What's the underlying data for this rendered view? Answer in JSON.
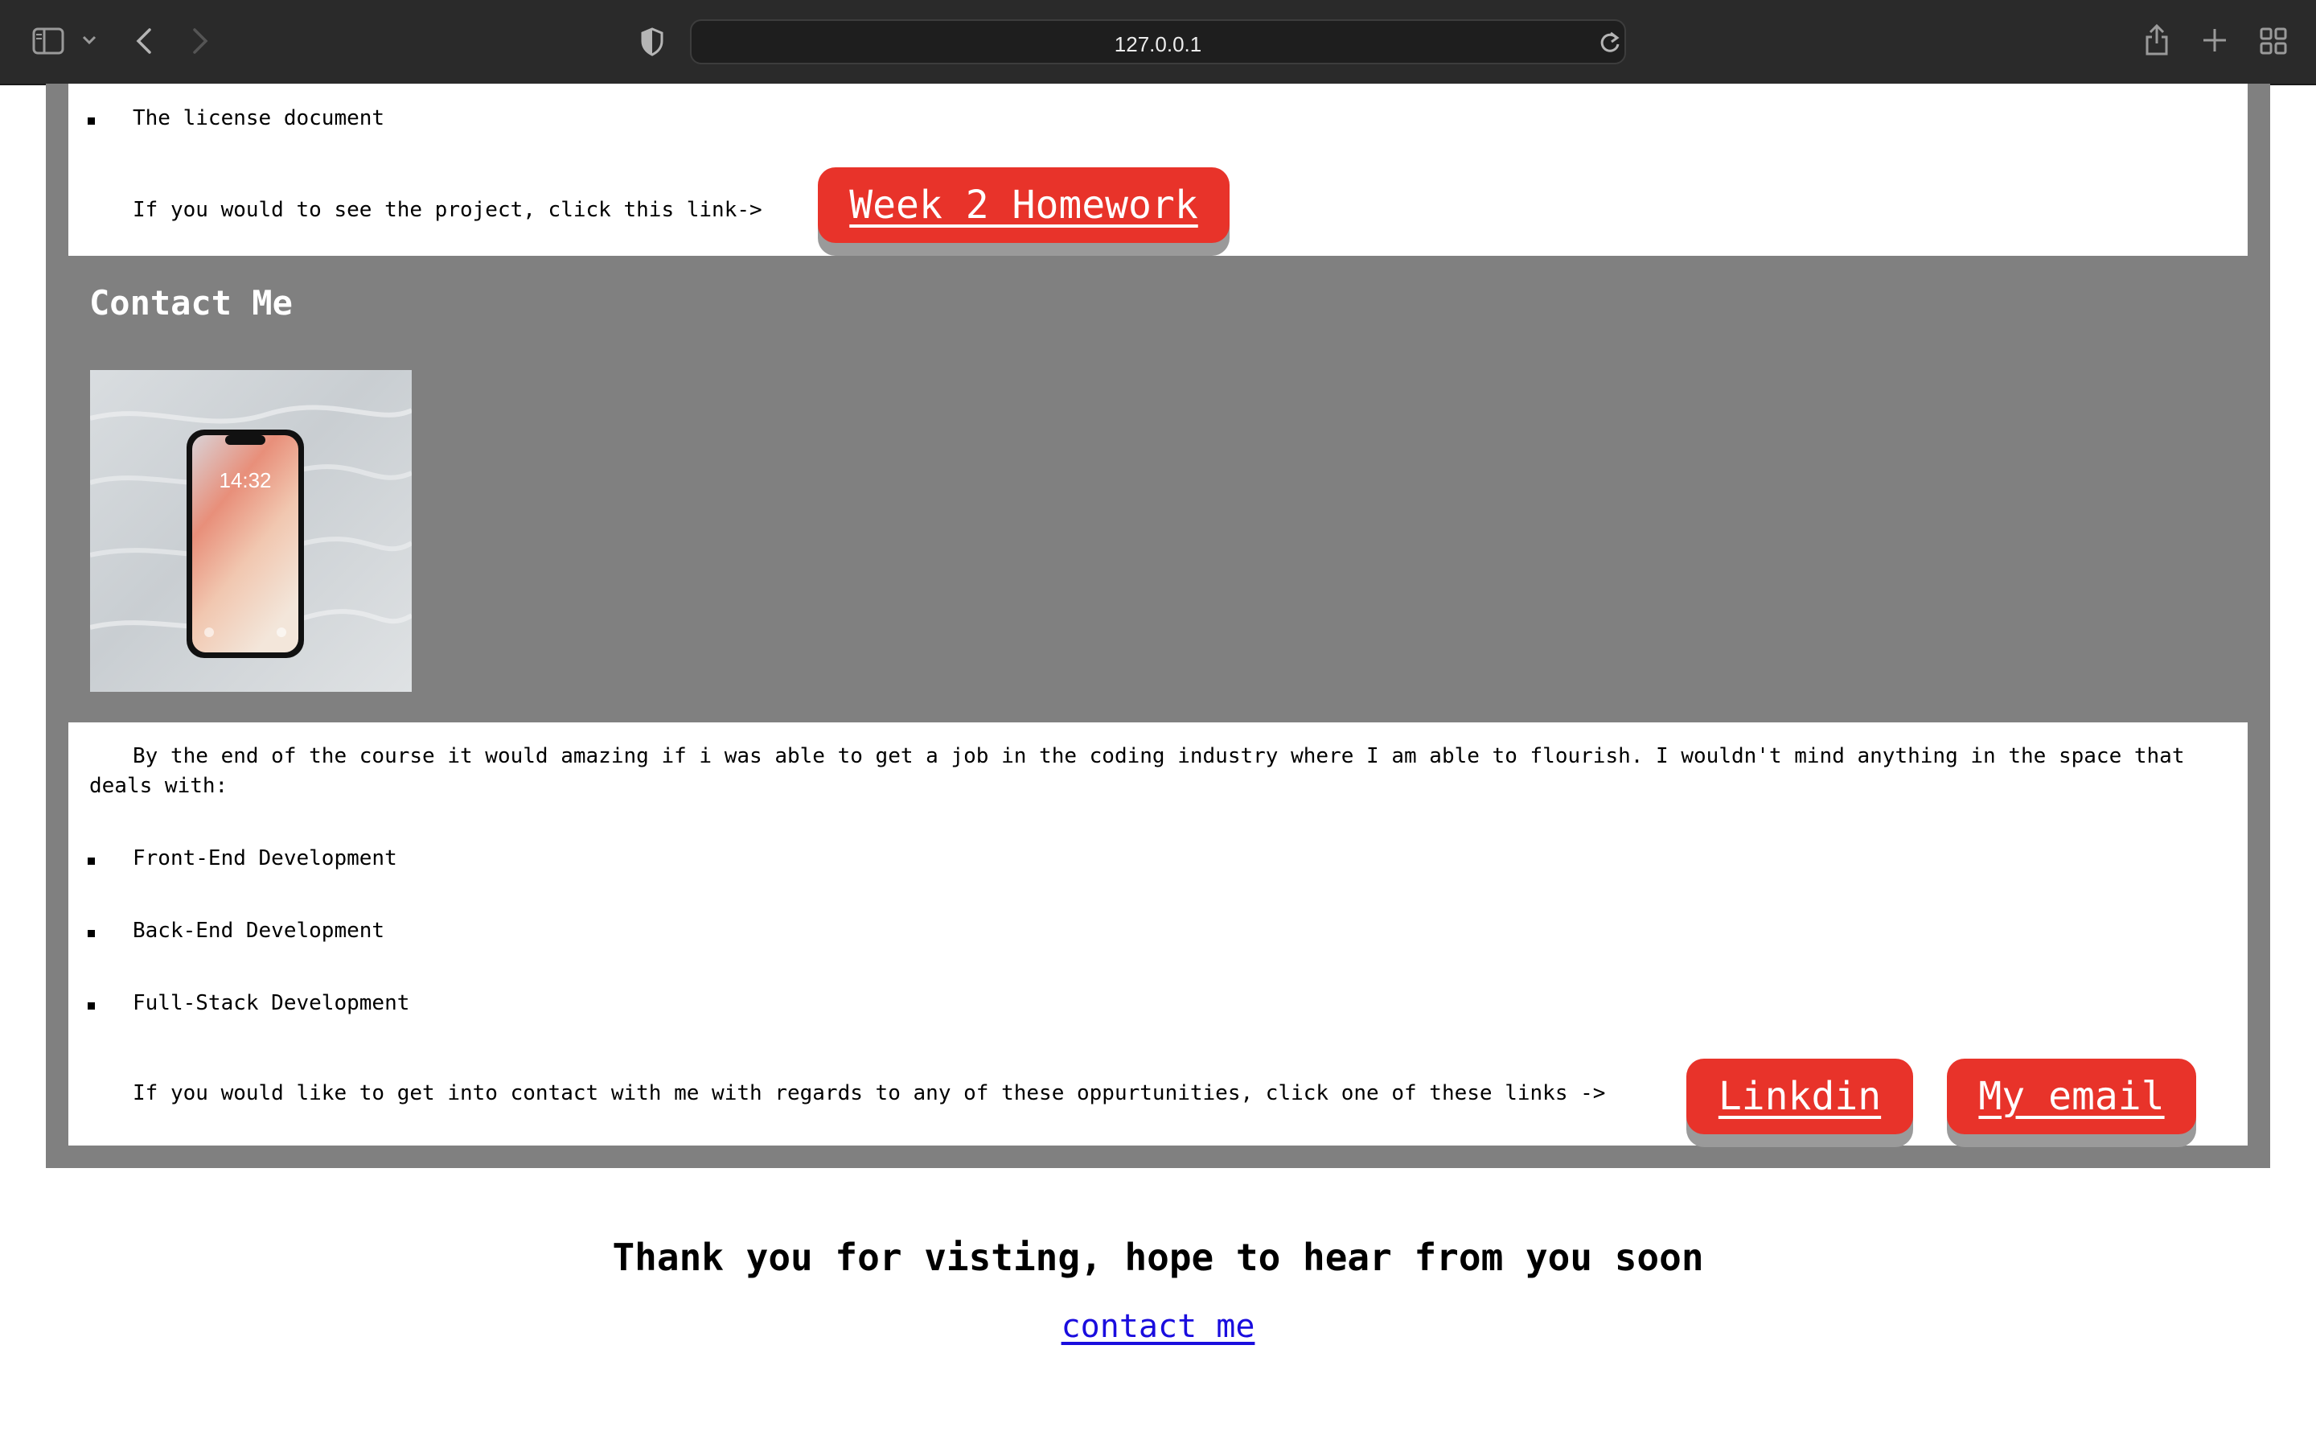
{
  "browser": {
    "url": "127.0.0.1",
    "toolbar_bg": "#2a2a2a"
  },
  "top_section": {
    "list_item": "The license document",
    "project_prompt": "If you would to see the project, click this link->",
    "project_button": "Week 2 Homework"
  },
  "contact_section": {
    "heading": "Contact Me",
    "phone_time": "14:32",
    "paragraph": "By the end of the course it would amazing if i was able to get a job in the coding industry where I am able to flourish. I wouldn't mind anything in the space that deals with:",
    "list": [
      "Front-End Development",
      "Back-End Development",
      "Full-Stack Development"
    ],
    "contact_prompt": "If you would like to get into contact with me with regards to any of these oppurtunities, click one of these links ->",
    "linkedin_button": "Linkdin",
    "email_button": "My email"
  },
  "footer": {
    "thanks": "Thank you for visting, hope to hear from you soon",
    "contact_link": "contact me"
  },
  "colors": {
    "button_red": "#e8332a",
    "section_gray": "#808080",
    "link_blue": "#1a0dde"
  },
  "icons": [
    "sidebar-icon",
    "chevron-down-icon",
    "back-arrow-icon",
    "forward-arrow-icon",
    "shield-icon",
    "reload-icon",
    "share-icon",
    "new-tab-icon",
    "tab-overview-icon"
  ]
}
